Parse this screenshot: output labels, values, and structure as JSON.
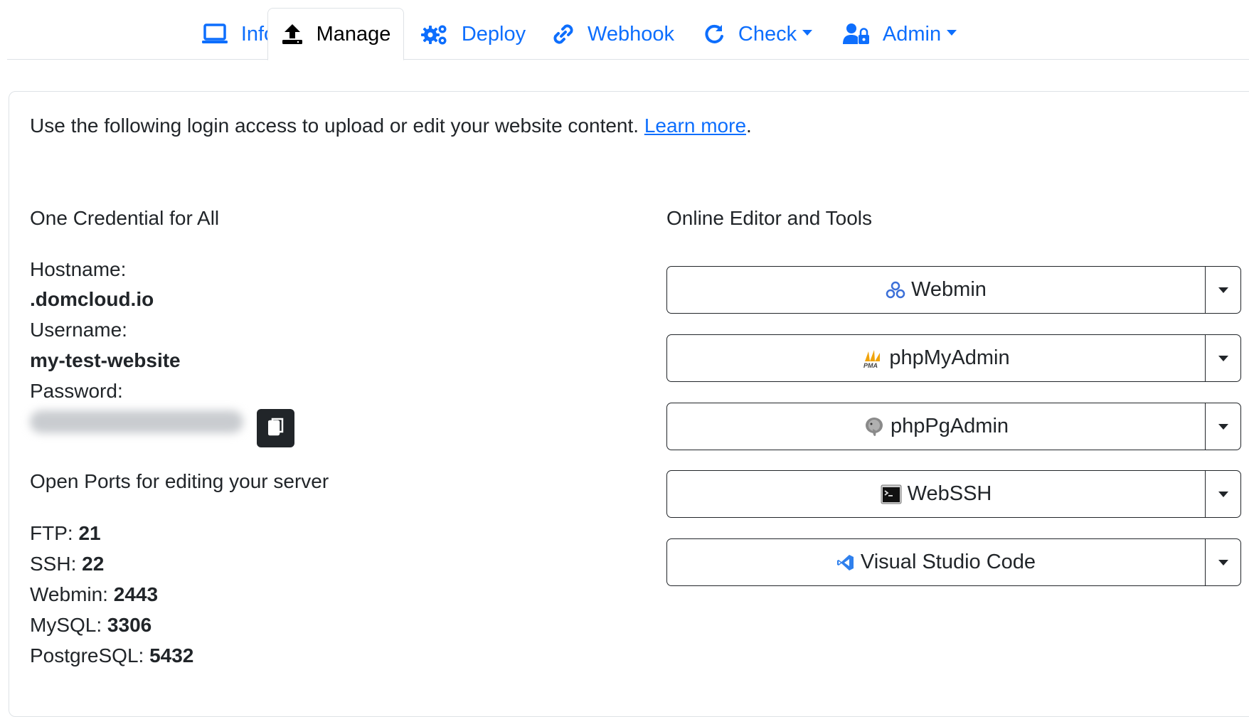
{
  "tabs": [
    {
      "label": "Info",
      "icon": "laptop-icon"
    },
    {
      "label": "Manage",
      "icon": "upload-icon",
      "active": true
    },
    {
      "label": "Deploy",
      "icon": "gears-icon"
    },
    {
      "label": "Webhook",
      "icon": "link-icon"
    },
    {
      "label": "Check",
      "icon": "refresh-icon",
      "dropdown": true
    },
    {
      "label": "Admin",
      "icon": "user-lock-icon",
      "dropdown": true
    }
  ],
  "intro": {
    "text": "Use the following login access to upload or edit your website content. ",
    "link": "Learn more",
    "suffix": "."
  },
  "credentials": {
    "heading": "One Credential for All",
    "hostname_label": "Hostname:",
    "hostname_value": ".domcloud.io",
    "username_label": "Username:",
    "username_value": "my-test-website",
    "password_label": "Password:",
    "copy_icon": "copy-icon"
  },
  "ports": {
    "heading": "Open Ports for editing your server",
    "items": [
      {
        "label": "FTP: ",
        "value": "21"
      },
      {
        "label": "SSH: ",
        "value": "22"
      },
      {
        "label": "Webmin: ",
        "value": "2443"
      },
      {
        "label": "MySQL: ",
        "value": "3306"
      },
      {
        "label": "PostgreSQL: ",
        "value": "5432"
      }
    ]
  },
  "tools": {
    "heading": "Online Editor and Tools",
    "items": [
      {
        "label": "Webmin",
        "icon": "webmin-icon"
      },
      {
        "label": "phpMyAdmin",
        "icon": "phpmyadmin-icon"
      },
      {
        "label": "phpPgAdmin",
        "icon": "postgresql-elephant-icon"
      },
      {
        "label": "WebSSH",
        "icon": "terminal-icon"
      },
      {
        "label": "Visual Studio Code",
        "icon": "vscode-icon"
      }
    ]
  },
  "colors": {
    "accent": "#0d6efd",
    "dark": "#212529",
    "border": "#dee2e6"
  }
}
